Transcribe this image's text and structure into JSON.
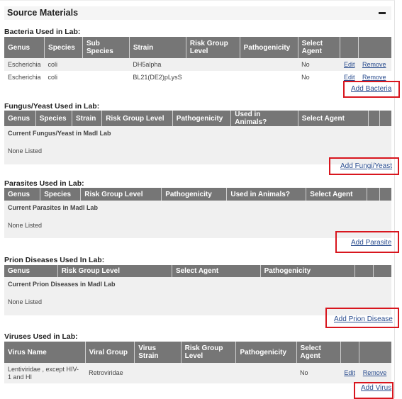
{
  "panel": {
    "title": "Source Materials",
    "collapse_icon": "minus-icon"
  },
  "bacteria": {
    "title": "Bacteria Used in Lab:",
    "columns": [
      "Genus",
      "Species",
      "Sub Species",
      "Strain",
      "Risk Group Level",
      "Pathogenicity",
      "Select Agent",
      "",
      ""
    ],
    "rows": [
      {
        "genus": "Escherichia",
        "species": "coli",
        "sub_species": "",
        "strain": "DH5alpha",
        "risk_group_level": "",
        "pathogenicity": "",
        "select_agent": "No",
        "edit": "Edit",
        "remove": "Remove"
      },
      {
        "genus": "Escherichia",
        "species": "coli",
        "sub_species": "",
        "strain": "BL21(DE2)pLysS",
        "risk_group_level": "",
        "pathogenicity": "",
        "select_agent": "No",
        "edit": "Edit",
        "remove": "Remove"
      }
    ],
    "add_label": "Add Bacteria"
  },
  "fungus": {
    "title": "Fungus/Yeast Used in Lab:",
    "columns": [
      "Genus",
      "Species",
      "Strain",
      "Risk Group Level",
      "Pathogenicity",
      "Used in Animals?",
      "Select Agent",
      "",
      ""
    ],
    "current_label": "Current Fungus/Yeast in Madl Lab",
    "none_label": "None Listed",
    "add_label": "Add Fungi/Yeast"
  },
  "parasites": {
    "title": "Parasites Used in Lab:",
    "columns": [
      "Genus",
      "Species",
      "Risk Group Level",
      "Pathogenicity",
      "Used in Animals?",
      "Select Agent",
      "",
      ""
    ],
    "current_label": "Current Parasites in Madl Lab",
    "none_label": "None Listed",
    "add_label": "Add Parasite"
  },
  "prions": {
    "title": "Prion Diseases Used In Lab:",
    "columns": [
      "Genus",
      "Risk Group Level",
      "Select Agent",
      "Pathogenicity",
      "",
      ""
    ],
    "current_label": "Current Prion Diseases in Madl Lab",
    "none_label": "None Listed",
    "add_label": "Add Prion Disease"
  },
  "viruses": {
    "title": "Viruses Used in Lab:",
    "columns": [
      "Virus Name",
      "Viral Group",
      "Virus Strain",
      "Risk Group Level",
      "Pathogenicity",
      "Select Agent",
      "",
      ""
    ],
    "rows": [
      {
        "virus_name": "Lentiviridae , except HIV-1 and HI",
        "viral_group": "Retroviridae",
        "virus_strain": "",
        "risk_group_level": "",
        "pathogenicity": "",
        "select_agent": "No",
        "edit": "Edit",
        "remove": "Remove"
      }
    ],
    "add_label": "Add Virus"
  },
  "colors": {
    "header_bg": "#767676",
    "alt_row_bg": "#f0f0f0",
    "link": "#2a4d8f",
    "highlight": "#d8161e"
  }
}
